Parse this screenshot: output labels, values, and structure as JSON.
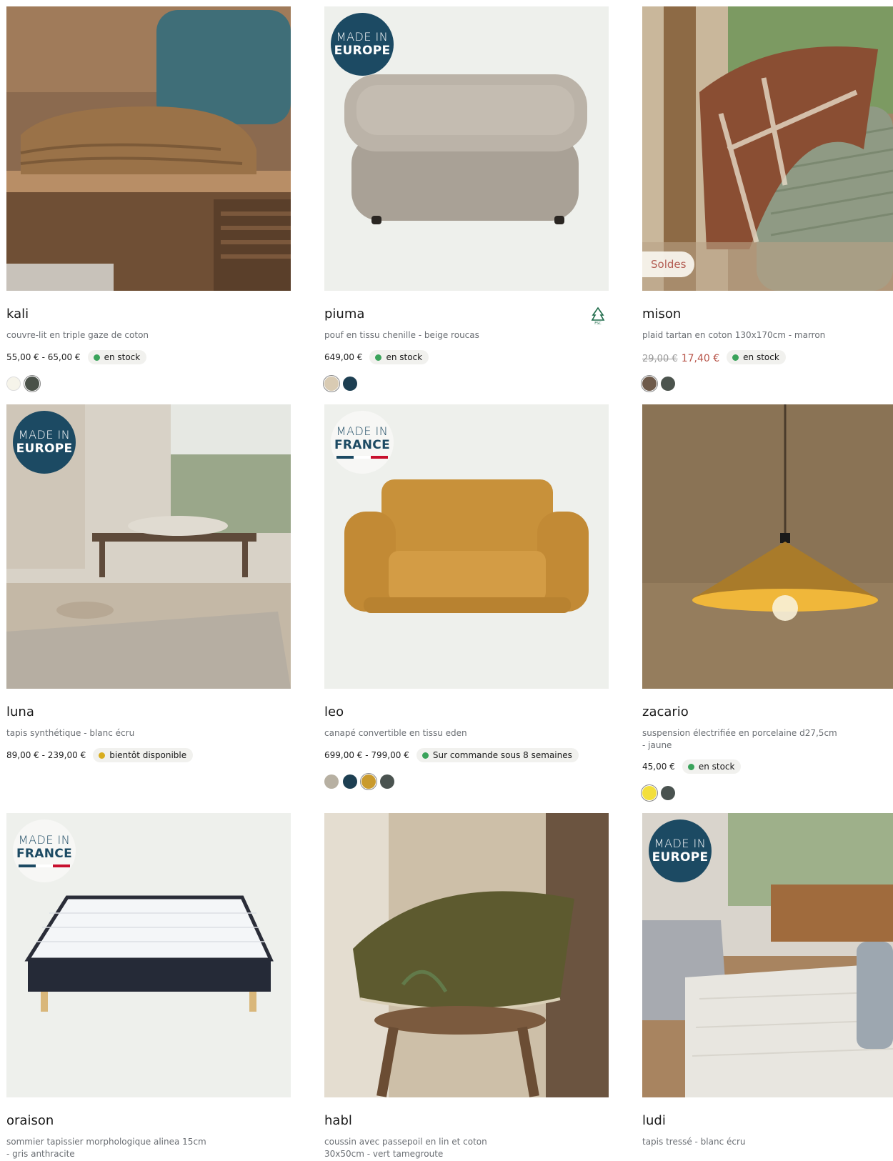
{
  "products": [
    {
      "name": "kali",
      "description": "couvre-lit en triple gaze de coton",
      "price": "55,00 € - 65,00 €",
      "stock": "en stock",
      "stock_color": "#3aa35b",
      "swatches": [
        "#f6f4ea",
        "#4a5149"
      ]
    },
    {
      "name": "piuma",
      "description": "pouf en tissu chenille - beige roucas",
      "price": "649,00 €",
      "stock": "en stock",
      "stock_color": "#3aa35b",
      "badge": {
        "line1": "MADE IN",
        "line2": "EUROPE"
      },
      "fsc_icon": "fsc-tree-icon",
      "swatches": [
        "#d9cbb3",
        "#1d3f52"
      ]
    },
    {
      "name": "mison",
      "description": "plaid tartan en coton 130x170cm - marron",
      "old_price": "29,00 €",
      "sale_price": "17,40 €",
      "stock": "en stock",
      "stock_color": "#3aa35b",
      "sale_label": "Soldes",
      "swatches": [
        "#6e5a4a",
        "#4c544e"
      ]
    },
    {
      "name": "luna",
      "description": "tapis synthétique - blanc écru",
      "price": "89,00 € - 239,00 €",
      "stock": "bientôt disponible",
      "stock_color": "#d8ad1e",
      "badge": {
        "line1": "MADE IN",
        "line2": "EUROPE"
      }
    },
    {
      "name": "leo",
      "description": "canapé convertible en tissu eden",
      "price": "699,00 € - 799,00 €",
      "stock": "Sur commande sous 8 semaines",
      "stock_color": "#3aa35b",
      "badge": {
        "line1": "MADE IN",
        "line2": "FRANCE"
      },
      "swatches": [
        "#b7b0a2",
        "#1d3f52",
        "#c99a2e",
        "#4a5350"
      ]
    },
    {
      "name": "zacario",
      "description": "suspension électrifiée en porcelaine d27,5cm - jaune",
      "price": "45,00 €",
      "stock": "en stock",
      "stock_color": "#3aa35b",
      "swatches": [
        "#f3df3c",
        "#4a5350"
      ]
    },
    {
      "name": "oraison",
      "description": "sommier tapissier morphologique alinea 15cm - gris anthracite",
      "badge": {
        "line1": "MADE IN",
        "line2": "FRANCE"
      }
    },
    {
      "name": "habl",
      "description": "coussin avec passepoil en lin et coton 30x50cm - vert tamegroute"
    },
    {
      "name": "ludi",
      "description": "tapis tressé - blanc écru",
      "badge": {
        "line1": "MADE IN",
        "line2": "EUROPE"
      }
    }
  ],
  "colors": {
    "europe_badge": "#1c4a63",
    "sale_red": "#b8554a",
    "stock_green": "#3aa35b",
    "stock_yellow": "#d8ad1e",
    "flag_blue": "#1c4a63",
    "flag_red": "#c8102e"
  }
}
